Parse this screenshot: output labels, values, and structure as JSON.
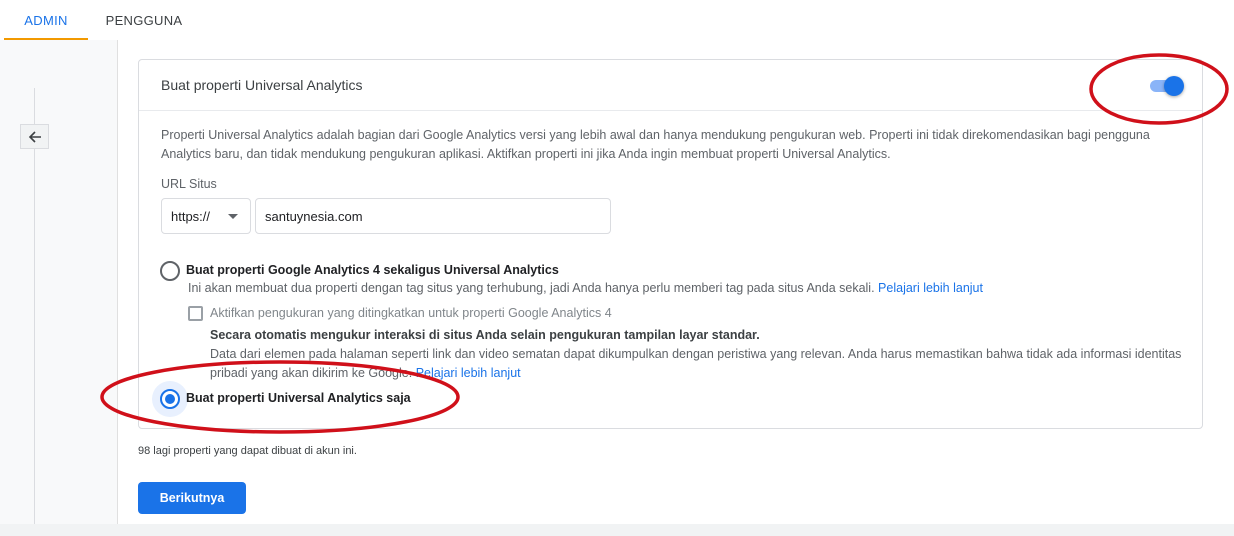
{
  "tabs": [
    {
      "label": "ADMIN",
      "active": true
    },
    {
      "label": "PENGGUNA",
      "active": false
    }
  ],
  "card": {
    "title": "Buat properti Universal Analytics",
    "toggle_on": true,
    "description": "Properti Universal Analytics adalah bagian dari Google Analytics versi yang lebih awal dan hanya mendukung pengukuran web. Properti ini tidak direkomendasikan bagi pengguna Analytics baru, dan tidak mendukung pengukuran aplikasi. Aktifkan properti ini jika Anda ingin membuat properti Universal Analytics.",
    "url_label": "URL Situs",
    "protocol": "https://",
    "url_value": "santuynesia.com",
    "option1": {
      "label": "Buat properti Google Analytics 4 sekaligus Universal Analytics",
      "description": "Ini akan membuat dua properti dengan tag situs yang terhubung, jadi Anda hanya perlu memberi tag pada situs Anda sekali.",
      "link": "Pelajari lebih lanjut",
      "selected": false
    },
    "checkbox": {
      "label": "Aktifkan pengukuran yang ditingkatkan untuk properti Google Analytics 4",
      "subtitle": "Secara otomatis mengukur interaksi di situs Anda selain pengukuran tampilan layar standar.",
      "description": "Data dari elemen pada halaman seperti link dan video sematan dapat dikumpulkan dengan peristiwa yang relevan. Anda harus memastikan bahwa tidak ada informasi identitas pribadi yang akan dikirim ke Google.",
      "link": "Pelajari lebih lanjut",
      "checked": false
    },
    "option2": {
      "label": "Buat properti Universal Analytics saja",
      "selected": true
    }
  },
  "quota_text": "98 lagi properti yang dapat dibuat di akun ini.",
  "next_button": "Berikutnya",
  "colors": {
    "accent": "#1a73e8",
    "tab_indicator": "#f29900",
    "annotation": "#d0101a"
  }
}
